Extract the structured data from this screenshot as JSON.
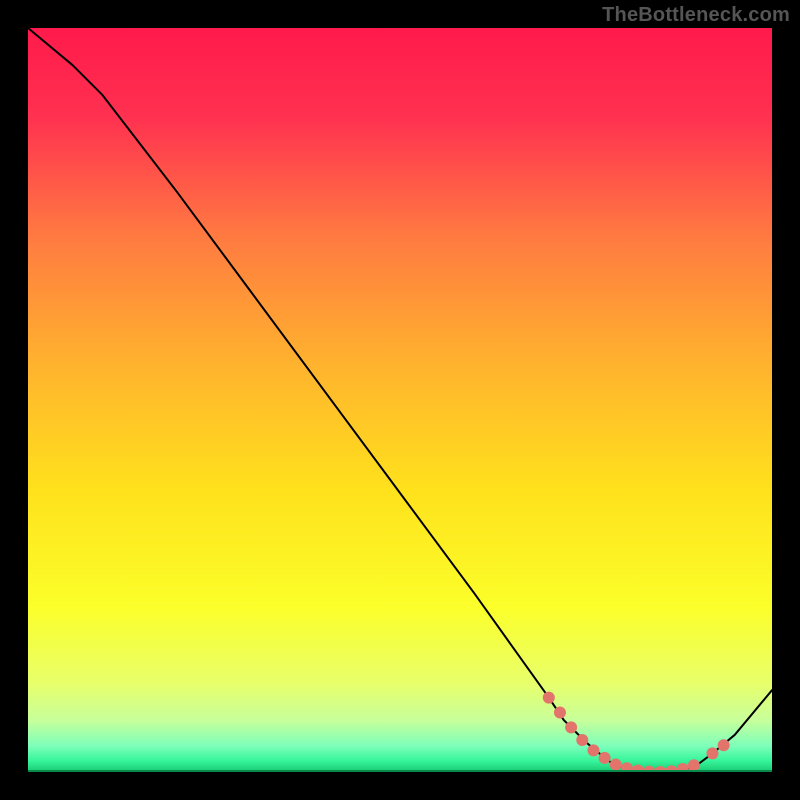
{
  "watermark": "TheBottleneck.com",
  "chart_data": {
    "type": "line",
    "title": "",
    "xlabel": "",
    "ylabel": "",
    "xlim": [
      0,
      100
    ],
    "ylim": [
      0,
      100
    ],
    "x": [
      0,
      6,
      10,
      20,
      30,
      40,
      50,
      60,
      65,
      70,
      72,
      75,
      78,
      80,
      82,
      85,
      88,
      90,
      92,
      95,
      100
    ],
    "values": [
      100,
      95,
      91,
      78,
      64.5,
      51,
      37.5,
      24,
      17,
      10,
      7,
      4,
      1.5,
      0.5,
      0.2,
      0,
      0.2,
      1,
      2.5,
      5,
      11
    ],
    "series": [
      {
        "name": "curve",
        "color": "#000000",
        "x": [
          0,
          6,
          10,
          20,
          30,
          40,
          50,
          60,
          65,
          70,
          72,
          75,
          78,
          80,
          82,
          85,
          88,
          90,
          92,
          95,
          100
        ],
        "values": [
          100,
          95,
          91,
          78,
          64.5,
          51,
          37.5,
          24,
          17,
          10,
          7,
          4,
          1.5,
          0.5,
          0.2,
          0,
          0.2,
          1,
          2.5,
          5,
          11
        ]
      }
    ],
    "markers": {
      "color": "#e2746c",
      "radius": 6,
      "points": [
        {
          "x": 70.0,
          "y": 10.0
        },
        {
          "x": 71.5,
          "y": 8.0
        },
        {
          "x": 73.0,
          "y": 6.0
        },
        {
          "x": 74.5,
          "y": 4.3
        },
        {
          "x": 76.0,
          "y": 2.9
        },
        {
          "x": 77.5,
          "y": 1.9
        },
        {
          "x": 79.0,
          "y": 1.0
        },
        {
          "x": 80.5,
          "y": 0.5
        },
        {
          "x": 82.0,
          "y": 0.2
        },
        {
          "x": 83.5,
          "y": 0.05
        },
        {
          "x": 85.0,
          "y": 0.0
        },
        {
          "x": 86.5,
          "y": 0.1
        },
        {
          "x": 88.0,
          "y": 0.4
        },
        {
          "x": 89.5,
          "y": 0.9
        },
        {
          "x": 92.0,
          "y": 2.5
        },
        {
          "x": 93.5,
          "y": 3.6
        }
      ]
    },
    "gradient_stops": [
      {
        "pos": 0.0,
        "color": "#ff1a4b"
      },
      {
        "pos": 0.12,
        "color": "#ff3150"
      },
      {
        "pos": 0.28,
        "color": "#ff7a41"
      },
      {
        "pos": 0.45,
        "color": "#ffb22e"
      },
      {
        "pos": 0.62,
        "color": "#ffe11c"
      },
      {
        "pos": 0.78,
        "color": "#fbff2a"
      },
      {
        "pos": 0.88,
        "color": "#e8ff6a"
      },
      {
        "pos": 0.93,
        "color": "#c8ff9a"
      },
      {
        "pos": 0.965,
        "color": "#7dffba"
      },
      {
        "pos": 0.985,
        "color": "#36f59a"
      },
      {
        "pos": 1.0,
        "color": "#18c972"
      }
    ]
  }
}
